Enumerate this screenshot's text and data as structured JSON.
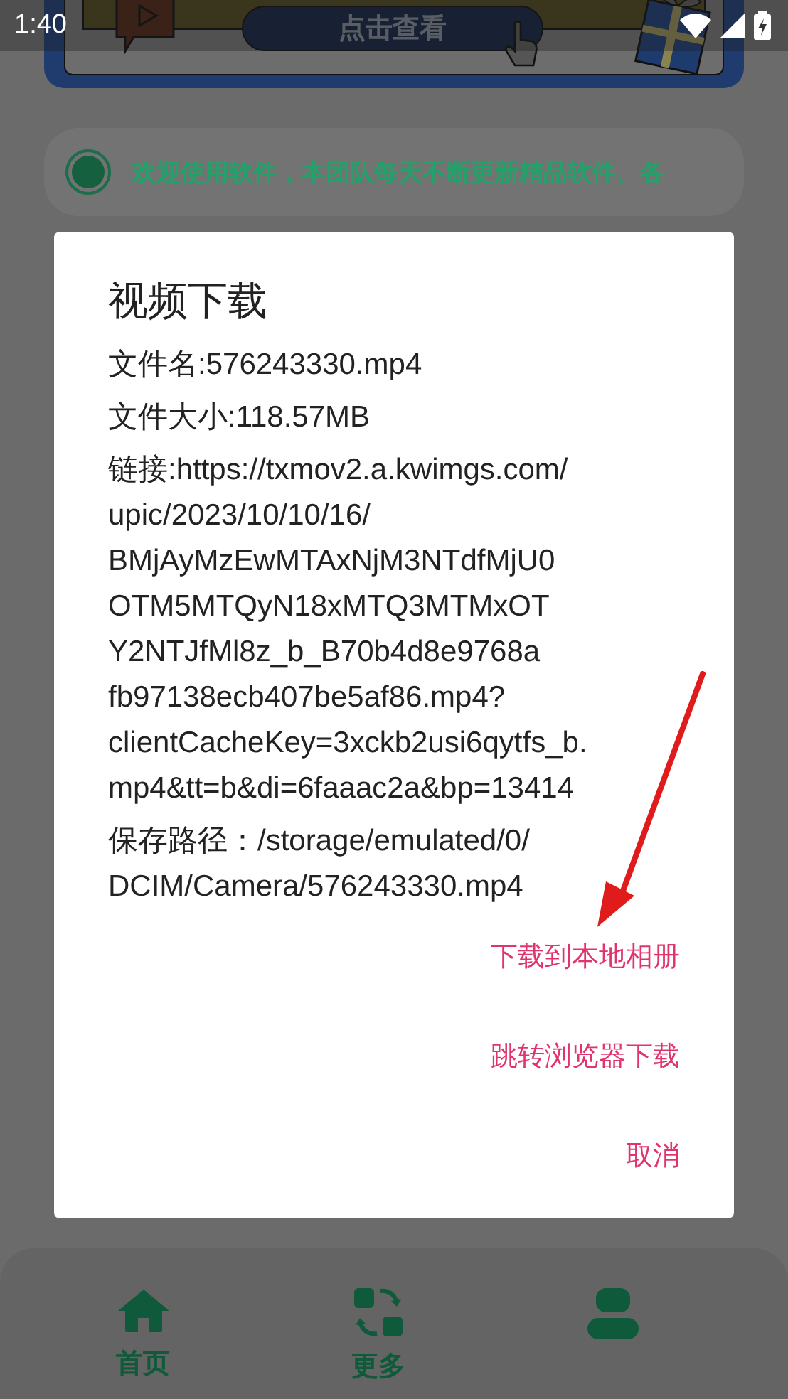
{
  "status_bar": {
    "time": "1:40"
  },
  "banner": {
    "button": "点击查看"
  },
  "notice": {
    "text": "欢迎使用软件，本团队每天不断更新精品软件、各"
  },
  "dialog": {
    "title": "视频下载",
    "file_name": "文件名:576243330.mp4",
    "file_size": "文件大小:118.57MB",
    "link_lines": [
      "链接:https://txmov2.a.kwimgs.com/",
      "upic/2023/10/10/16/",
      "BMjAyMzEwMTAxNjM3NTdfMjU0",
      "OTM5MTQyN18xMTQ3MTMxOT",
      "Y2NTJfMl8z_b_B70b4d8e9768a",
      "fb97138ecb407be5af86.mp4?",
      "clientCacheKey=3xckb2usi6qytfs_b.",
      "mp4&tt=b&di=6faaac2a&bp=13414"
    ],
    "save_path_lines": [
      "保存路径：/storage/emulated/0/",
      "DCIM/Camera/576243330.mp4"
    ],
    "actions": [
      "下载到本地相册",
      "跳转浏览器下载",
      "取消"
    ]
  },
  "bottom_nav": [
    {
      "kind": "home",
      "label": "首页"
    },
    {
      "kind": "more",
      "label": "更多"
    },
    {
      "kind": "user"
    }
  ]
}
